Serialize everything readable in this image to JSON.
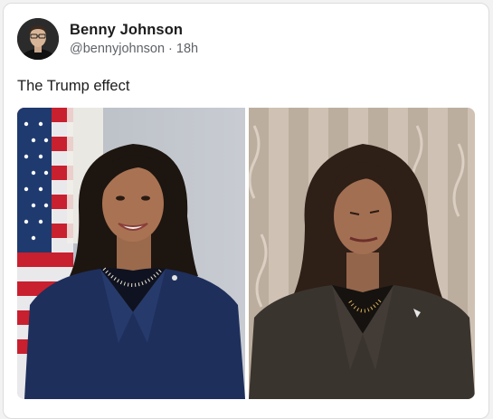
{
  "post": {
    "author_name": "Benny Johnson",
    "handle": "@bennyjohnson",
    "separator": "·",
    "time": "18h",
    "text": "The Trump effect"
  },
  "media": [
    {
      "icon": "portrait-photo"
    },
    {
      "icon": "portrait-photo"
    }
  ],
  "colors": {
    "card_bg": "#ffffff",
    "card_border": "#dcdcdc",
    "name": "#1c1c1c",
    "handle": "#5f6368"
  }
}
